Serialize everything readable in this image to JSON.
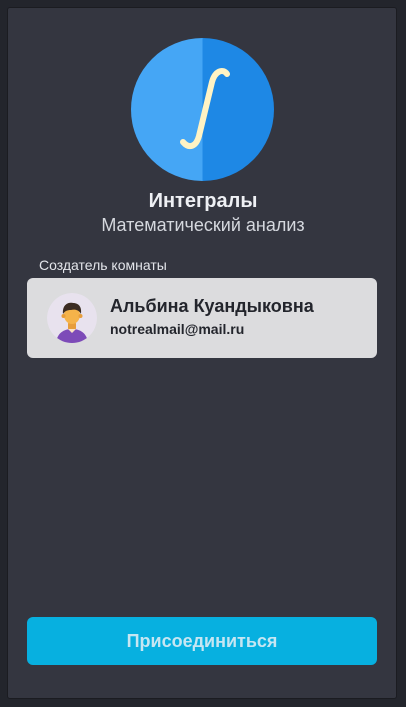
{
  "room": {
    "icon": "integral-icon",
    "title": "Интегралы",
    "subject": "Математический анализ"
  },
  "creator_section": {
    "label": "Создатель комнаты"
  },
  "creator": {
    "avatar": "user-avatar",
    "name": "Альбина Куандыковна",
    "email": "notrealmail@mail.ru"
  },
  "actions": {
    "join_label": "Присоединиться"
  },
  "colors": {
    "background": "#343640",
    "card": "#dcdcde",
    "accent": "#07b0e0",
    "icon_light_blue": "#45a6f5",
    "icon_dark_blue": "#1e88e5"
  }
}
